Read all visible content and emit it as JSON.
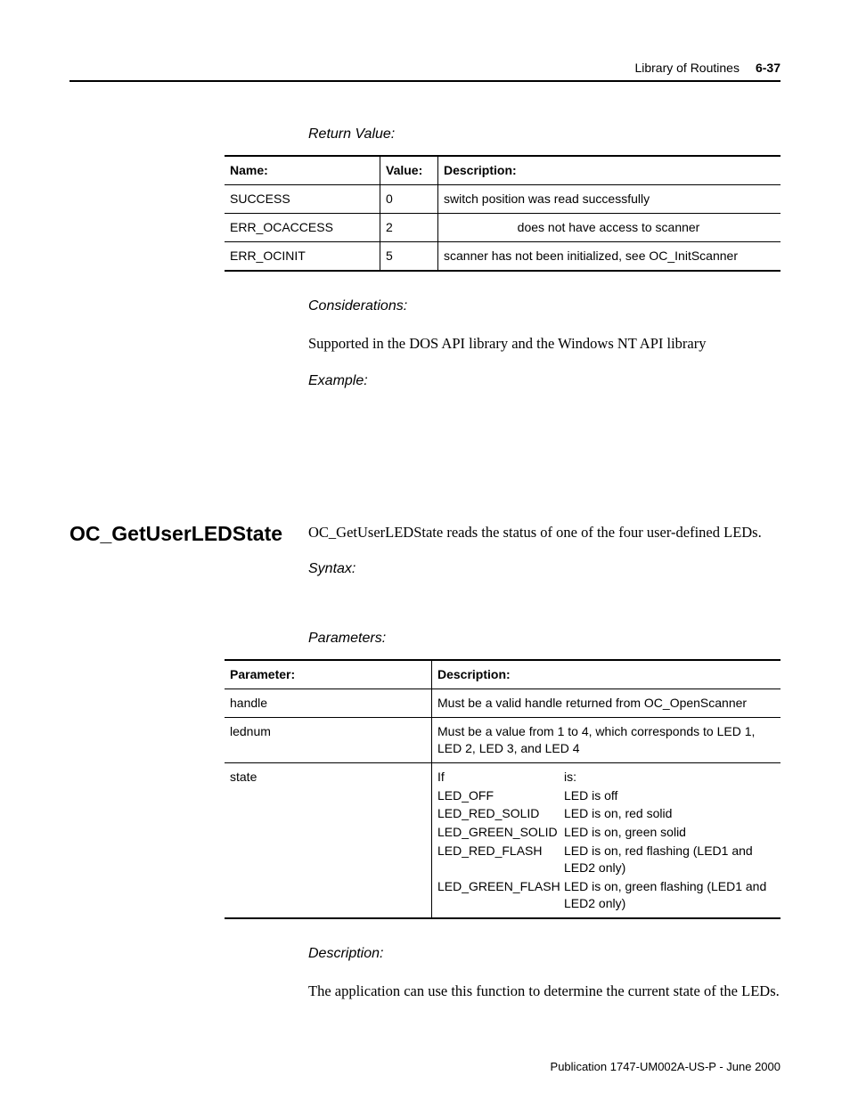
{
  "header": {
    "section_title": "Library of Routines",
    "section_num": "6-37"
  },
  "headings": {
    "return_value": "Return Value:",
    "considerations": "Considerations:",
    "example": "Example:",
    "syntax": "Syntax:",
    "parameters": "Parameters:",
    "description": "Description:"
  },
  "return_table": {
    "head": {
      "name": "Name:",
      "value": "Value:",
      "desc": "Description:"
    },
    "rows": [
      {
        "name": "SUCCESS",
        "value": "0",
        "desc": "switch position was read successfully",
        "center": false
      },
      {
        "name": "ERR_OCACCESS",
        "value": "2",
        "desc": "does not have access to scanner",
        "center": true
      },
      {
        "name": "ERR_OCINIT",
        "value": "5",
        "desc": "scanner has not been initialized, see OC_InitScanner",
        "center": false
      }
    ]
  },
  "considerations_text": "Supported in the DOS API library and the Windows NT API library",
  "section2": {
    "title": "OC_GetUserLEDState",
    "intro": "OC_GetUserLEDState reads the status of one of the four user-defined LEDs."
  },
  "param_table": {
    "head": {
      "param": "Parameter:",
      "desc": "Description:"
    },
    "rows": {
      "handle": {
        "param": "handle",
        "desc": "Must be a valid handle returned from OC_OpenScanner"
      },
      "lednum": {
        "param": "lednum",
        "desc": "Must be a value from 1 to 4, which corresponds to LED 1, LED 2, LED 3, and LED 4"
      },
      "state": {
        "param": "state",
        "if_label": "If",
        "is_label": "is:",
        "items": [
          {
            "k": "LED_OFF",
            "v": "LED is off"
          },
          {
            "k": "LED_RED_SOLID",
            "v": "LED is on, red solid"
          },
          {
            "k": "LED_GREEN_SOLID",
            "v": "LED is on, green solid"
          },
          {
            "k": "LED_RED_FLASH",
            "v": "LED is on, red flashing (LED1 and LED2 only)"
          },
          {
            "k": "LED_GREEN_FLASH",
            "v": "LED is on, green flashing (LED1 and LED2 only)"
          }
        ]
      }
    }
  },
  "description_text": "The application can use this function to determine the current state of the LEDs.",
  "footer": "Publication 1747-UM002A-US-P - June 2000"
}
